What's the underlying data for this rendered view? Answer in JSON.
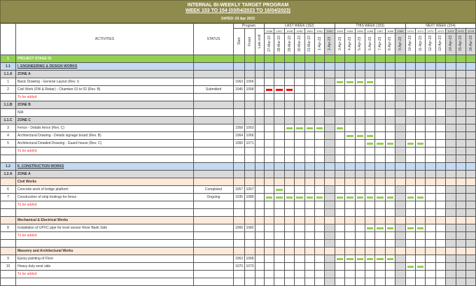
{
  "header": {
    "title": "INTERNAL BI-WEEKLY TARGET PROGRAM",
    "subtitle": "WEEK 153 TO 154 (03/04/2023 TO 16/04/2023)",
    "dated": "DATED: 03 Apr 2023"
  },
  "columns": {
    "activities": "ACTIVITIES",
    "status": "STATUS",
    "program": "Program",
    "start": "Start",
    "finish": "Finish",
    "late_end": "Late end"
  },
  "weeks": [
    {
      "label": "LAST WEEK (152)"
    },
    {
      "label": "THIS WEEK (153)"
    },
    {
      "label": "NEXT WEEK (154)"
    }
  ],
  "days": [
    {
      "num": "1056",
      "date": "27-Mar-23",
      "weekend": false
    },
    {
      "num": "1057",
      "date": "28-Mar-23",
      "weekend": false
    },
    {
      "num": "1058",
      "date": "29-Mar-23",
      "weekend": false
    },
    {
      "num": "1059",
      "date": "30-Mar-23",
      "weekend": false
    },
    {
      "num": "1060",
      "date": "31-Mar-23",
      "weekend": false
    },
    {
      "num": "1061",
      "date": "1-Apr-23",
      "weekend": false
    },
    {
      "num": "1062",
      "date": "2-Apr-23",
      "weekend": true
    },
    {
      "num": "1063",
      "date": "3-Apr-23",
      "weekend": false
    },
    {
      "num": "1064",
      "date": "4-Apr-23",
      "weekend": false
    },
    {
      "num": "1065",
      "date": "5-Apr-23",
      "weekend": false
    },
    {
      "num": "1066",
      "date": "6-Apr-23",
      "weekend": false
    },
    {
      "num": "1067",
      "date": "7-Apr-23",
      "weekend": false
    },
    {
      "num": "1068",
      "date": "8-Apr-23",
      "weekend": false
    },
    {
      "num": "1069",
      "date": "9-Apr-23",
      "weekend": true
    },
    {
      "num": "1070",
      "date": "10-Apr-23",
      "weekend": false
    },
    {
      "num": "1071",
      "date": "11-Apr-23",
      "weekend": false
    },
    {
      "num": "1072",
      "date": "12-Apr-23",
      "weekend": false
    },
    {
      "num": "1073",
      "date": "13-Apr-23",
      "weekend": false
    },
    {
      "num": "1074",
      "date": "14-Apr-23",
      "weekend": true
    },
    {
      "num": "1075",
      "date": "15-Apr-23",
      "weekend": true
    },
    {
      "num": "1076",
      "date": "16-Apr-23",
      "weekend": true
    }
  ],
  "colors": {
    "planned": "#92d050",
    "delayed": "#ff0000"
  },
  "rows": [
    {
      "type": "stage",
      "num": "1",
      "label": "PROJECT STAGE 01"
    },
    {
      "type": "section",
      "num": "1.1",
      "label": "I. ENGINEERING & DESIGN WORKS"
    },
    {
      "type": "zone",
      "num": "1.1.A",
      "label": "ZONE A"
    },
    {
      "type": "task",
      "num": "1",
      "label": "Basic Drawing - General Layout (Rev. I)",
      "status": "",
      "start": "1063",
      "finish": "1066",
      "bars": [
        1063,
        1064,
        1065,
        1066
      ],
      "color": "planned"
    },
    {
      "type": "task",
      "num": "2",
      "label": "Civil Work (FW & Rebar) - Chamber 01 to 02 (Rev. B)",
      "status": "Submitted",
      "start": "1045",
      "finish": "1058",
      "bars": [
        1056,
        1057,
        1058
      ],
      "color": "delayed"
    },
    {
      "type": "todo",
      "num": "",
      "label": "To be added"
    },
    {
      "type": "zone",
      "num": "1.1.B",
      "label": "ZONE B"
    },
    {
      "type": "task",
      "num": "",
      "label": "N/A",
      "status": "",
      "start": "",
      "finish": "",
      "bars": []
    },
    {
      "type": "zone",
      "num": "1.1.C",
      "label": "ZONE C"
    },
    {
      "type": "task",
      "num": "3",
      "label": "Fence - Details fence (Rev. C)",
      "status": "",
      "start": "1058",
      "finish": "1063",
      "bars": [
        1058,
        1059,
        1060,
        1061,
        1063
      ],
      "color": "planned"
    },
    {
      "type": "task",
      "num": "4",
      "label": "Architectural Drawing - Details signage board (Rev. B)",
      "status": "",
      "start": "1064",
      "finish": "1066",
      "bars": [
        1064,
        1065,
        1066
      ],
      "color": "planned"
    },
    {
      "type": "task",
      "num": "5",
      "label": "Architectural Detailed Drawing -  Guard house (Rev. C)",
      "status": "",
      "start": "1066",
      "finish": "1071",
      "bars": [
        1066,
        1067,
        1068,
        1070,
        1071
      ],
      "color": "planned"
    },
    {
      "type": "todo",
      "num": "",
      "label": "To be added"
    },
    {
      "type": "blank"
    },
    {
      "type": "section",
      "num": "1.2",
      "label": "II. CONSTRUCTION WORKS"
    },
    {
      "type": "zone",
      "num": "1.2.A",
      "label": "ZONE A"
    },
    {
      "type": "group",
      "num": "",
      "label": "Civil Works"
    },
    {
      "type": "task",
      "num": "6",
      "label": "Concrete work of bridge platform",
      "status": "Completed",
      "start": "1057",
      "finish": "1057",
      "bars": [
        1057
      ],
      "color": "planned"
    },
    {
      "type": "task",
      "num": "7",
      "label": "Construction of strip footings for fence",
      "status": "Ongoing",
      "start": "1035",
      "finish": "1089",
      "bars": [
        1056,
        1057,
        1058,
        1059,
        1060,
        1061,
        1063,
        1064,
        1065,
        1066,
        1067,
        1068,
        1070,
        1071
      ],
      "color": "planned"
    },
    {
      "type": "todo",
      "num": "",
      "label": "To be added"
    },
    {
      "type": "blank"
    },
    {
      "type": "group",
      "num": "",
      "label": "Mechanical & Electrical Works"
    },
    {
      "type": "task",
      "num": "8",
      "label": "Installation of UPVC pipe for level sensor River Bank Side",
      "status": "",
      "start": "1066",
      "finish": "1082",
      "bars": [
        1066,
        1067,
        1068,
        1070,
        1071
      ],
      "color": "planned"
    },
    {
      "type": "todo",
      "num": "",
      "label": "To be added"
    },
    {
      "type": "blank"
    },
    {
      "type": "group",
      "num": "",
      "label": "Masonry and Architectural Works"
    },
    {
      "type": "task",
      "num": "9",
      "label": "Epoxy painting of Floor",
      "status": "",
      "start": "1063",
      "finish": "1068",
      "bars": [
        1063,
        1064,
        1065,
        1066,
        1067,
        1068
      ],
      "color": "planned"
    },
    {
      "type": "task",
      "num": "10",
      "label": "Heavy duty west side",
      "status": "",
      "start": "1070",
      "finish": "1073",
      "bars": [
        1070,
        1071
      ],
      "color": "planned"
    },
    {
      "type": "todo",
      "num": "",
      "label": "To be added"
    },
    {
      "type": "blank"
    }
  ]
}
